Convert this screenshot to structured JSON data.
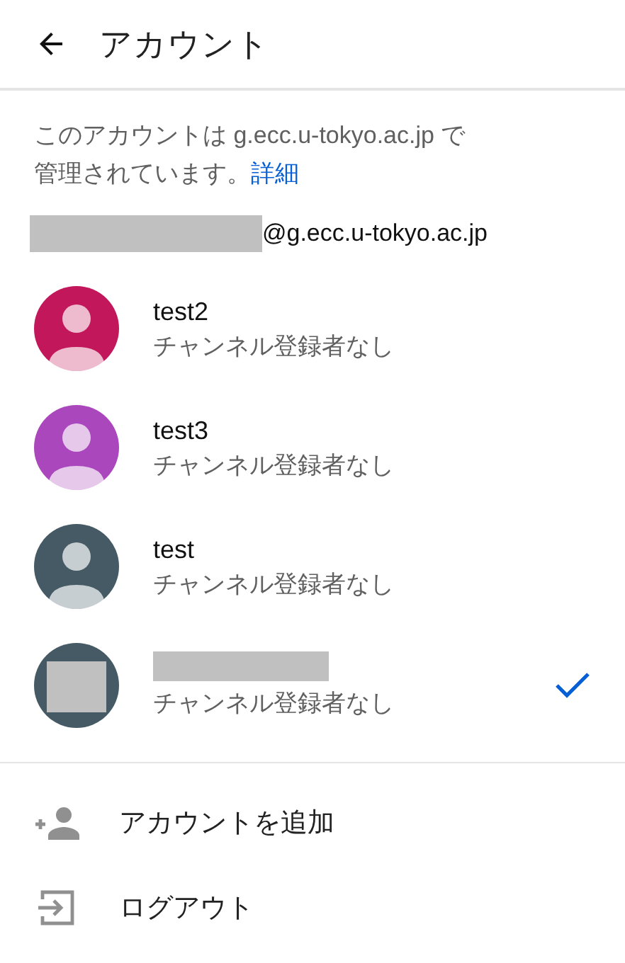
{
  "header": {
    "title": "アカウント"
  },
  "notice": {
    "text": "このアカウントは g.ecc.u-tokyo.ac.jp で管理されています。",
    "link": "詳細"
  },
  "email": {
    "redacted_prefix": true,
    "text": "@g.ecc.u-tokyo.ac.jp"
  },
  "accounts": [
    {
      "kind": "person",
      "color": "#c2185b",
      "name": "test2",
      "subtitle": "チャンネル登録者なし",
      "selected": false
    },
    {
      "kind": "person",
      "color": "#ab47bc",
      "name": "test3",
      "subtitle": "チャンネル登録者なし",
      "selected": false
    },
    {
      "kind": "person",
      "color": "#455a64",
      "name": "test",
      "subtitle": "チャンネル登録者なし",
      "selected": false
    },
    {
      "kind": "redacted",
      "color": "#455a64",
      "redacted_name": true,
      "subtitle": "チャンネル登録者なし",
      "selected": true
    }
  ],
  "actions": [
    {
      "kind": "add",
      "label": "アカウントを追加"
    },
    {
      "kind": "logout",
      "label": "ログアウト"
    }
  ]
}
